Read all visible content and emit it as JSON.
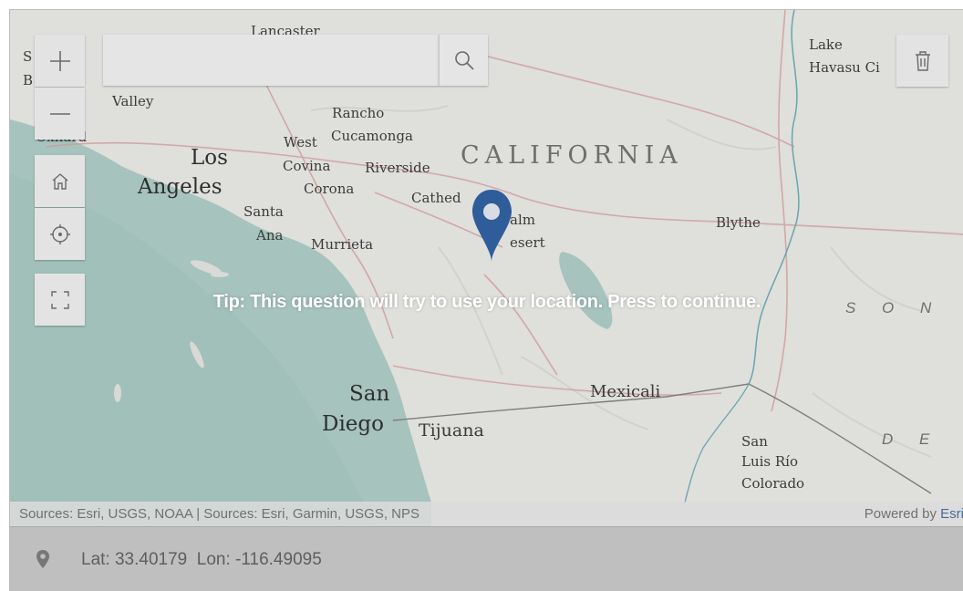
{
  "map": {
    "labels": {
      "lancaster": "Lancaster",
      "valley": "Valley",
      "oxnard": "Oxnard",
      "rancho": "Rancho",
      "cucamonga": "Cucamonga",
      "west": "West",
      "los": "Los",
      "angeles": "Angeles",
      "covina": "Covina",
      "riverside": "Riverside",
      "corona": "Corona",
      "santa": "Santa",
      "ana": "Ana",
      "murrieta": "Murrieta",
      "cathedral": "Cathed",
      "palm": "alm",
      "desert": "esert",
      "california": "CALIFORNIA",
      "blythe": "Blythe",
      "lake": "Lake",
      "havasu": "Havasu Ci",
      "s_left": "S",
      "b_left": "B",
      "son": "S  O  N",
      "de": "D  E",
      "san": "San",
      "diego": "Diego",
      "tijuana": "Tijuana",
      "mexicali": "Mexicali",
      "san_luis_1": "San",
      "san_luis_2": "Luis Río",
      "san_luis_3": "Colorado"
    },
    "tip": "Tip: This question will try to use your location. Press to continue.",
    "attribution_sources": "Sources: Esri, USGS, NOAA | Sources: Esri, Garmin, USGS, NPS",
    "attribution_powered": "Powered by ",
    "attribution_esri": "Esri"
  },
  "controls": {
    "zoom_in_icon": "plus-icon",
    "zoom_out_icon": "minus-icon",
    "home_icon": "home-icon",
    "locate_icon": "crosshair-icon",
    "fullscreen_icon": "fullscreen-icon",
    "search_icon": "search-icon",
    "trash_icon": "trash-icon"
  },
  "search": {
    "placeholder": "",
    "value": ""
  },
  "coords": {
    "text": "Lat: 33.40179  Lon: -116.49095",
    "icon": "map-pin-icon"
  },
  "colors": {
    "pin": "#2f5d9a",
    "ocean": "#8fb5ad",
    "overlay": "rgba(255,255,255,0.25)"
  }
}
